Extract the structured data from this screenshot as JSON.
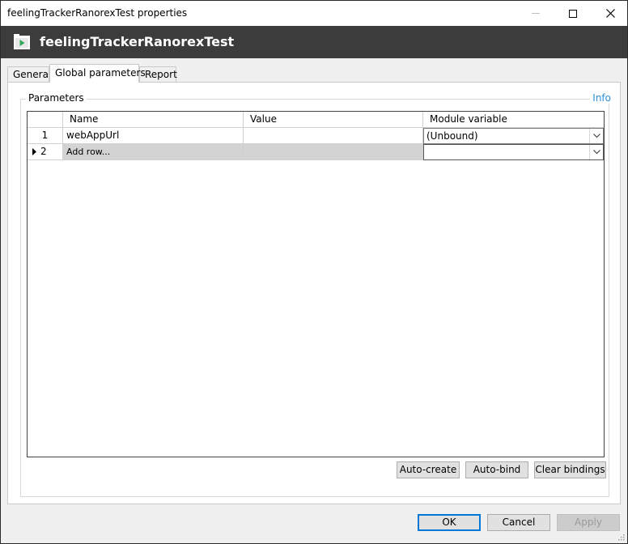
{
  "window": {
    "title": "feelingTrackerRanorexTest properties",
    "controls": {
      "minimize": "minimize-icon",
      "maximize": "maximize-icon",
      "close": "close-icon"
    }
  },
  "header": {
    "icon": "test-suite-icon",
    "title": "feelingTrackerRanorexTest"
  },
  "tabs": [
    {
      "label": "General",
      "selected": false
    },
    {
      "label": "Global parameters",
      "selected": true
    },
    {
      "label": "Report",
      "selected": false
    }
  ],
  "parameters": {
    "group_label": "Parameters",
    "info_link": "Info",
    "columns": [
      "Name",
      "Value",
      "Module variable"
    ],
    "rows": [
      {
        "number": "1",
        "name": "webAppUrl",
        "value": "",
        "module_variable": "(Unbound)"
      },
      {
        "number": "2",
        "name": "Add row...",
        "value": "",
        "module_variable": ""
      }
    ]
  },
  "panel_buttons": {
    "auto_create": "Auto-create",
    "auto_bind": "Auto-bind",
    "clear_bindings": "Clear bindings"
  },
  "dialog_buttons": {
    "ok": "OK",
    "cancel": "Cancel",
    "apply": "Apply"
  },
  "colors": {
    "header_bg": "#3c3c3c",
    "accent": "#0078d7",
    "info_link": "#2b8fd8",
    "icon_green": "#2fa85a"
  }
}
